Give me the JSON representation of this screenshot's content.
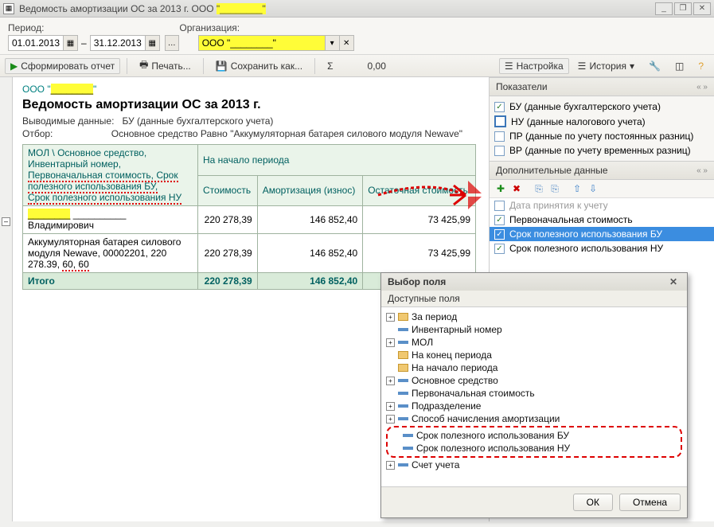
{
  "window": {
    "title_prefix": "Ведомость амортизации ОС за 2013 г. ООО ",
    "title_highlight": "\"________\"",
    "min": "_",
    "max": "❐",
    "close": "✕"
  },
  "filters": {
    "period_label": "Период:",
    "org_label": "Организация:",
    "date_from": "01.01.2013",
    "date_to": "31.12.2013",
    "sep": "–",
    "org_value": "ООО \"________\""
  },
  "toolbar": {
    "form": "Сформировать отчет",
    "print": "Печать...",
    "save": "Сохранить как...",
    "sigma": "Σ",
    "sigma_val": "0,00",
    "settings": "Настройка",
    "history": "История"
  },
  "report": {
    "org": "ООО \"________\"",
    "title": "Ведомость амортизации ОС за 2013 г.",
    "meta1_label": "Выводимые данные:",
    "meta1_val": "БУ (данные бухгалтерского учета)",
    "meta2_label": "Отбор:",
    "meta2_val": "Основное средство Равно \"Аккумуляторная батарея силового модуля Newave\"",
    "hdr_left1": "МОЛ \\ Основное средство,",
    "hdr_left2": "Инвентарный номер,",
    "hdr_left3": "Первоначальная стоимость, Срок полезного использования БУ,",
    "hdr_left4": "Срок полезного использования НУ",
    "hdr_period": "На начало периода",
    "hdr_cost": "Стоимость",
    "hdr_amort": "Амортизация (износ)",
    "hdr_rest": "Остаточная стоимость",
    "row1_name": "__________ Владимирович",
    "row1_cost": "220 278,39",
    "row1_amort": "146 852,40",
    "row1_rest": "73 425,99",
    "row2_name": "Аккумуляторная батарея силового модуля Newave, 00002201, 220 278.39, 60, 60",
    "row2_cost": "220 278,39",
    "row2_amort": "146 852,40",
    "row2_rest": "73 425,99",
    "total_label": "Итого",
    "total_cost": "220 278,39",
    "total_amort": "146 852,40"
  },
  "side": {
    "indicators_title": "Показатели",
    "ind": [
      {
        "c": true,
        "t": "БУ (данные бухгалтерского учета)"
      },
      {
        "c": false,
        "t": "НУ (данные налогового учета)",
        "big": true
      },
      {
        "c": false,
        "t": "ПР (данные по учету постоянных разниц)"
      },
      {
        "c": false,
        "t": "ВР (данные по учету временных разниц)"
      }
    ],
    "extra_title": "Дополнительные данные",
    "extra": [
      {
        "c": false,
        "t": "Дата принятия к учету",
        "dis": true
      },
      {
        "c": true,
        "t": "Первоначальная стоимость"
      },
      {
        "c": true,
        "t": "Срок полезного использования БУ",
        "sel": true
      },
      {
        "c": true,
        "t": "Срок полезного использования НУ"
      }
    ]
  },
  "modal": {
    "title": "Выбор поля",
    "sub": "Доступные поля",
    "fields": [
      {
        "exp": true,
        "folder": true,
        "t": "За период"
      },
      {
        "exp": false,
        "folder": false,
        "t": "Инвентарный номер"
      },
      {
        "exp": true,
        "folder": false,
        "t": "МОЛ"
      },
      {
        "exp": false,
        "folder": true,
        "t": "На конец периода"
      },
      {
        "exp": false,
        "folder": true,
        "t": "На начало периода"
      },
      {
        "exp": true,
        "folder": false,
        "t": "Основное средство"
      },
      {
        "exp": false,
        "folder": false,
        "t": "Первоначальная стоимость"
      },
      {
        "exp": true,
        "folder": false,
        "t": "Подразделение"
      },
      {
        "exp": true,
        "folder": false,
        "t": "Способ начисления амортизации"
      },
      {
        "exp": false,
        "folder": false,
        "t": "Срок полезного использования БУ",
        "red": true
      },
      {
        "exp": false,
        "folder": false,
        "t": "Срок полезного использования НУ",
        "red": true
      },
      {
        "exp": true,
        "folder": false,
        "t": "Счет учета"
      }
    ],
    "ok": "ОК",
    "cancel": "Отмена"
  }
}
